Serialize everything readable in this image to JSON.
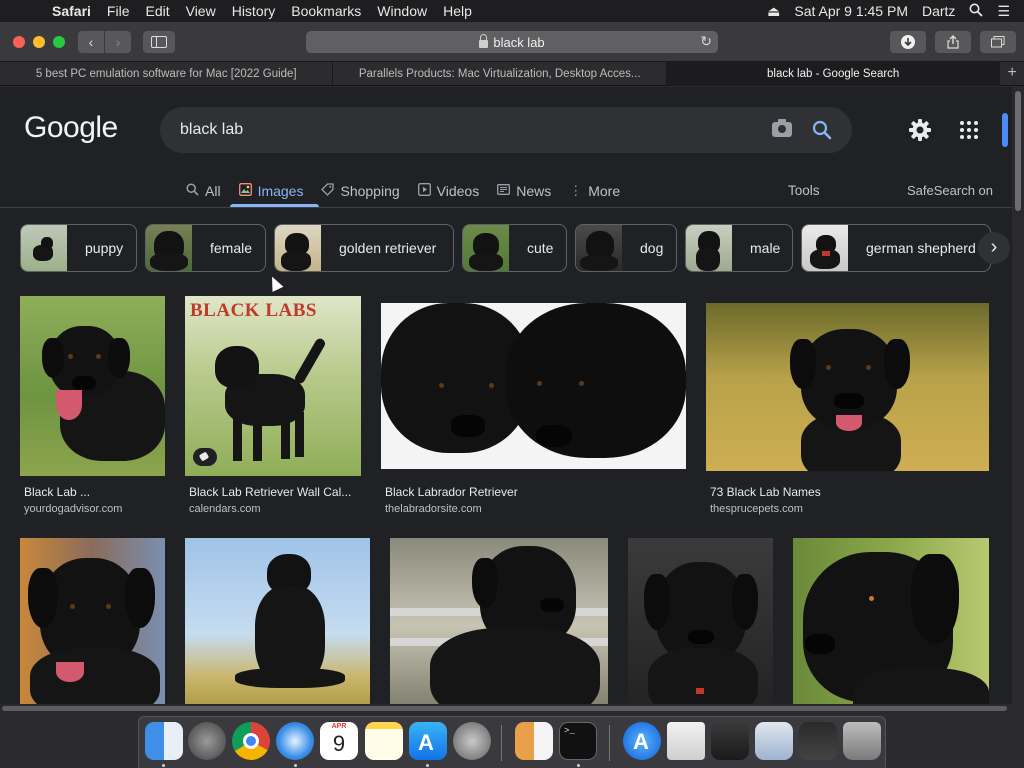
{
  "menubar": {
    "app": "Safari",
    "items": [
      "File",
      "Edit",
      "View",
      "History",
      "Bookmarks",
      "Window",
      "Help"
    ],
    "clock": "Sat Apr 9  1:45 PM",
    "user": "Dartz"
  },
  "toolbar": {
    "url": "black lab"
  },
  "tabs": [
    {
      "label": "5 best PC emulation software for Mac [2022 Guide]"
    },
    {
      "label": "Parallels Products: Mac Virtualization, Desktop Acces..."
    },
    {
      "label": "black lab - Google Search"
    }
  ],
  "google": {
    "logo": "Google",
    "query": "black lab",
    "nav": [
      "All",
      "Images",
      "Shopping",
      "Videos",
      "News",
      "More"
    ],
    "tools": "Tools",
    "safesearch": "SafeSearch on"
  },
  "chips": [
    "puppy",
    "female",
    "golden retriever",
    "cute",
    "dog",
    "male",
    "german shepherd"
  ],
  "results": [
    {
      "title": "Black Lab ...",
      "site": "yourdogadvisor.com",
      "banner": ""
    },
    {
      "title": "Black Lab Retriever Wall Cal...",
      "site": "calendars.com",
      "banner": "BLACK LABS"
    },
    {
      "title": "Black Labrador Retriever",
      "site": "thelabradorsite.com",
      "banner": ""
    },
    {
      "title": "73 Black Lab Names",
      "site": "thesprucepets.com",
      "banner": ""
    }
  ],
  "dock": {
    "calendar_month": "APR",
    "calendar_day": "9"
  }
}
